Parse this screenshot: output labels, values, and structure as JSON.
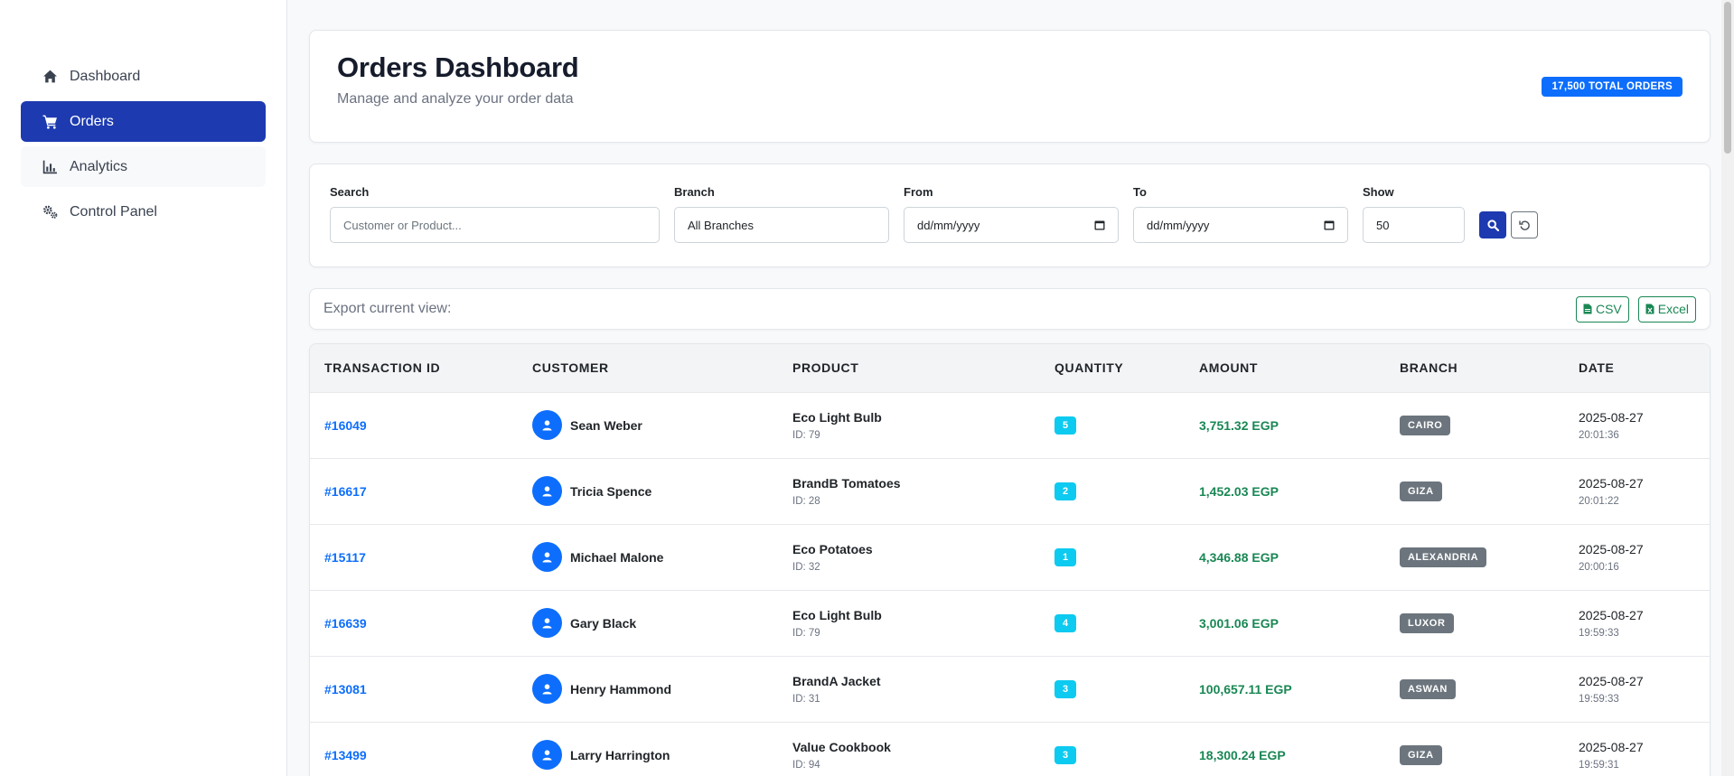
{
  "sidebar": {
    "items": [
      {
        "label": "Dashboard",
        "icon": "home-icon"
      },
      {
        "label": "Orders",
        "icon": "cart-icon"
      },
      {
        "label": "Analytics",
        "icon": "chart-icon"
      },
      {
        "label": "Control Panel",
        "icon": "gears-icon"
      }
    ]
  },
  "header": {
    "title": "Orders Dashboard",
    "subtitle": "Manage and analyze your order data",
    "badge": "17,500 TOTAL ORDERS"
  },
  "filters": {
    "search_label": "Search",
    "search_placeholder": "Customer or Product...",
    "branch_label": "Branch",
    "branch_value": "All Branches",
    "from_label": "From",
    "from_value": "dd/mm/yyyy",
    "to_label": "To",
    "to_value": "dd/mm/yyyy",
    "show_label": "Show",
    "show_value": "50"
  },
  "export": {
    "label": "Export current view:",
    "csv": "CSV",
    "excel": "Excel"
  },
  "table": {
    "headers": [
      "Transaction ID",
      "Customer",
      "Product",
      "Quantity",
      "Amount",
      "Branch",
      "Date"
    ],
    "rows": [
      {
        "id": "#16049",
        "customer": "Sean Weber",
        "product": "Eco Light Bulb",
        "product_id": "ID: 79",
        "qty": "5",
        "amount": "3,751.32 EGP",
        "branch": "CAIRO",
        "date": "2025-08-27",
        "time": "20:01:36"
      },
      {
        "id": "#16617",
        "customer": "Tricia Spence",
        "product": "BrandB Tomatoes",
        "product_id": "ID: 28",
        "qty": "2",
        "amount": "1,452.03 EGP",
        "branch": "GIZA",
        "date": "2025-08-27",
        "time": "20:01:22"
      },
      {
        "id": "#15117",
        "customer": "Michael Malone",
        "product": "Eco Potatoes",
        "product_id": "ID: 32",
        "qty": "1",
        "amount": "4,346.88 EGP",
        "branch": "ALEXANDRIA",
        "date": "2025-08-27",
        "time": "20:00:16"
      },
      {
        "id": "#16639",
        "customer": "Gary Black",
        "product": "Eco Light Bulb",
        "product_id": "ID: 79",
        "qty": "4",
        "amount": "3,001.06 EGP",
        "branch": "LUXOR",
        "date": "2025-08-27",
        "time": "19:59:33"
      },
      {
        "id": "#13081",
        "customer": "Henry Hammond",
        "product": "BrandA Jacket",
        "product_id": "ID: 31",
        "qty": "3",
        "amount": "100,657.11 EGP",
        "branch": "ASWAN",
        "date": "2025-08-27",
        "time": "19:59:33"
      },
      {
        "id": "#13499",
        "customer": "Larry Harrington",
        "product": "Value Cookbook",
        "product_id": "ID: 94",
        "qty": "3",
        "amount": "18,300.24 EGP",
        "branch": "GIZA",
        "date": "2025-08-27",
        "time": "19:59:31"
      }
    ]
  },
  "colors": {
    "primary": "#1d3ab0",
    "link": "#0d6efd",
    "success": "#198754",
    "info": "#0dcaf0",
    "secondary": "#6c757d"
  }
}
